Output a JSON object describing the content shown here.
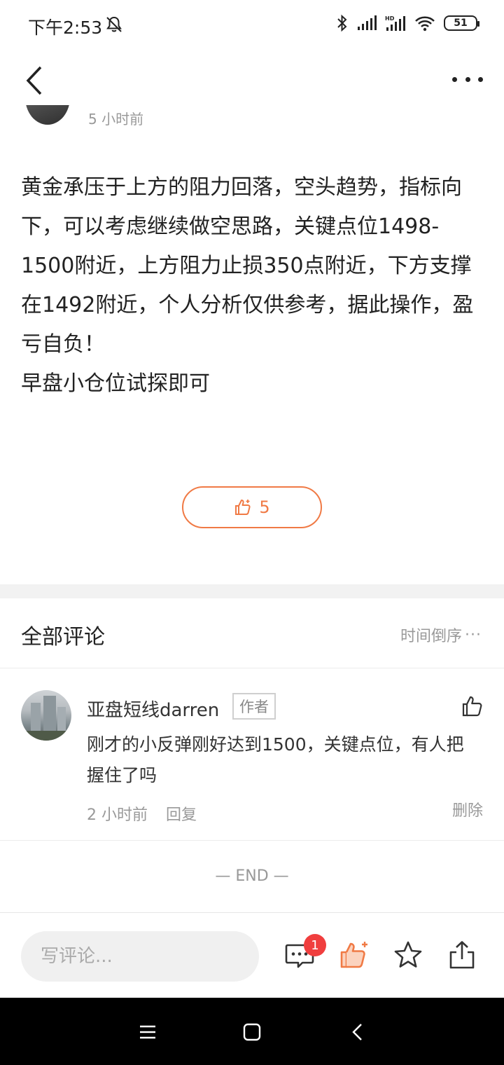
{
  "status_bar": {
    "time": "下午2:53",
    "battery": "51",
    "icons": [
      "bell-off-icon",
      "bluetooth-icon",
      "signal-icon",
      "hd-signal-icon",
      "wifi-icon",
      "battery-icon"
    ]
  },
  "header": {
    "back_icon": "chevron-left-icon",
    "more_icon": "more-dots-icon"
  },
  "post": {
    "time": "5 小时前",
    "paragraphs": [
      "黄金承压于上方的阻力回落，空头趋势，指标向下，可以考虑继续做空思路，关键点位1498-1500附近，上方阻力止损350点附近，下方支撑在1492附近，个人分析仅供参考，据此操作，盈亏自负！",
      "早盘小仓位试探即可"
    ],
    "like_count": "5",
    "accent_color": "#f07a45"
  },
  "comments": {
    "title": "全部评论",
    "sort_label": "时间倒序",
    "items": [
      {
        "author": "亚盘短线darren",
        "badge": "作者",
        "text": "刚才的小反弹刚好达到1500，关键点位，有人把握住了吗",
        "time": "2 小时前",
        "reply_label": "回复",
        "delete_label": "删除"
      }
    ],
    "end_label": "— END —"
  },
  "bottom_bar": {
    "input_placeholder": "写评论...",
    "comment_badge": "1",
    "icons": [
      "comment-icon",
      "thumbs-up-icon",
      "star-icon",
      "share-icon"
    ],
    "badge_color": "#f03e3e"
  },
  "nav_bar": {
    "icons": [
      "menu-icon",
      "home-square-icon",
      "back-triangle-icon"
    ]
  }
}
